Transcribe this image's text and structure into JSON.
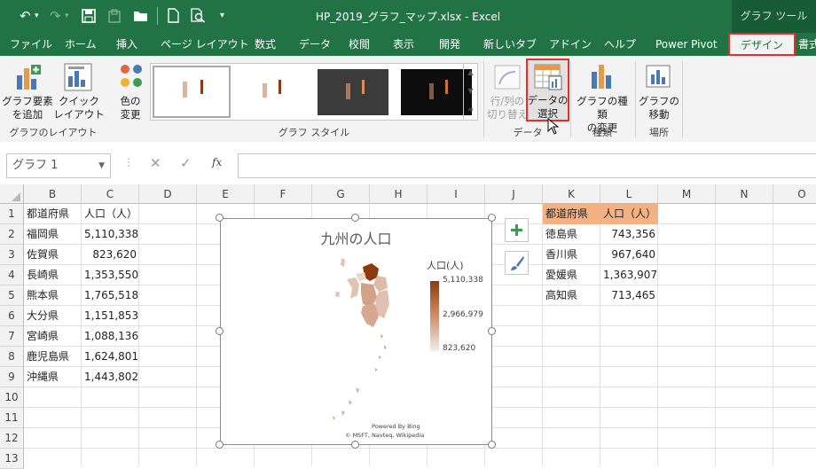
{
  "window": {
    "title": "HP_2019_グラフ_マップ.xlsx  -  Excel",
    "contextual_tools": "グラフ ツール"
  },
  "tabs": [
    "ファイル",
    "ホーム",
    "挿入",
    "ページ レイアウト",
    "数式",
    "データ",
    "校閲",
    "表示",
    "開発",
    "新しいタブ",
    "アドイン",
    "ヘルプ",
    "Power Pivot",
    "デザイン",
    "書式"
  ],
  "ribbon": {
    "add_element": "グラフ要素\nを追加",
    "quick_layout": "クイック\nレイアウト",
    "change_colors": "色の\n変更",
    "group_layout": "グラフのレイアウト",
    "group_styles": "グラフ スタイル",
    "switch_row_col": "行/列の\n切り替え",
    "select_data": "データの\n選択",
    "group_data": "データ",
    "change_type": "グラフの種類\nの変更",
    "group_type": "種類",
    "move_chart": "グラフの\n移動",
    "group_location": "場所"
  },
  "formula_bar": {
    "name_box": "グラフ 1",
    "fx": "fx"
  },
  "columns": [
    "B",
    "C",
    "D",
    "E",
    "F",
    "G",
    "H",
    "I",
    "J",
    "K",
    "L",
    "M",
    "N",
    "O"
  ],
  "rows": [
    "1",
    "2",
    "3",
    "4",
    "5",
    "6",
    "7",
    "8",
    "9",
    "10",
    "11",
    "12",
    "13"
  ],
  "table1": {
    "headers": [
      "都道府県",
      "人口（人）"
    ],
    "rows": [
      [
        "福岡県",
        "5,110,338"
      ],
      [
        "佐賀県",
        "823,620"
      ],
      [
        "長崎県",
        "1,353,550"
      ],
      [
        "熊本県",
        "1,765,518"
      ],
      [
        "大分県",
        "1,151,853"
      ],
      [
        "宮崎県",
        "1,088,136"
      ],
      [
        "鹿児島県",
        "1,624,801"
      ],
      [
        "沖縄県",
        "1,443,802"
      ]
    ]
  },
  "table2": {
    "headers": [
      "都道府県",
      "人口（人）"
    ],
    "rows": [
      [
        "徳島県",
        "743,356"
      ],
      [
        "香川県",
        "967,640"
      ],
      [
        "愛媛県",
        "1,363,907"
      ],
      [
        "高知県",
        "713,465"
      ]
    ]
  },
  "chart": {
    "title": "九州の人口",
    "legend_title": "人口(人)",
    "legend_max": "5,110,338",
    "legend_mid": "2,966,979",
    "legend_min": "823,620",
    "credit_line1": "Powered By Bing",
    "credit_line2": "© MSFT, Navteq, Wikipedia"
  },
  "colors": {
    "excel_green": "#217346",
    "highlight_red": "#e0312c",
    "header_orange": "#f4b183",
    "map_dark": "#8b3a0e"
  }
}
